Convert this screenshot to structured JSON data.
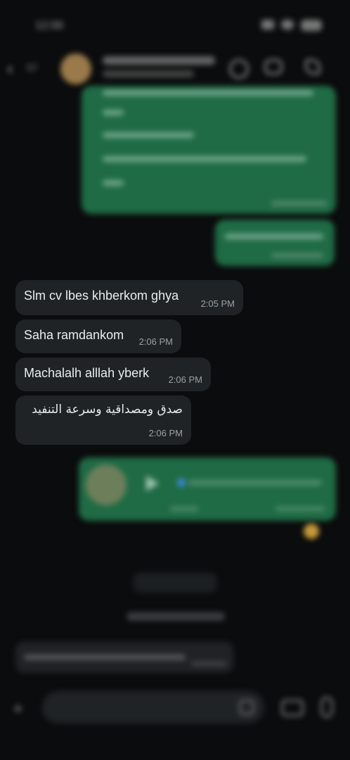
{
  "header": {
    "back_count": "57"
  },
  "messages": [
    {
      "id": "m1",
      "direction": "incoming",
      "text": "Slm cv lbes khberkom ghya",
      "time": "2:05 PM"
    },
    {
      "id": "m2",
      "direction": "incoming",
      "text": "Saha ramdankom",
      "time": "2:06 PM"
    },
    {
      "id": "m3",
      "direction": "incoming",
      "text": "Machalalh alllah yberk",
      "time": "2:06 PM"
    },
    {
      "id": "m4",
      "direction": "incoming",
      "text": "صدق ومصداقية وسرعة التنفيد",
      "time": "2:06 PM"
    }
  ],
  "colors": {
    "background": "#0b0c0d",
    "incoming_bubble": "#1f2326",
    "outgoing_bubble": "#1f6b45",
    "time_text": "#9aa0a6"
  },
  "icons": [
    "back-arrow-icon",
    "video-call-icon",
    "voice-call-icon",
    "plus-icon",
    "camera-icon",
    "mic-icon",
    "play-icon",
    "emoji-reaction-icon"
  ]
}
